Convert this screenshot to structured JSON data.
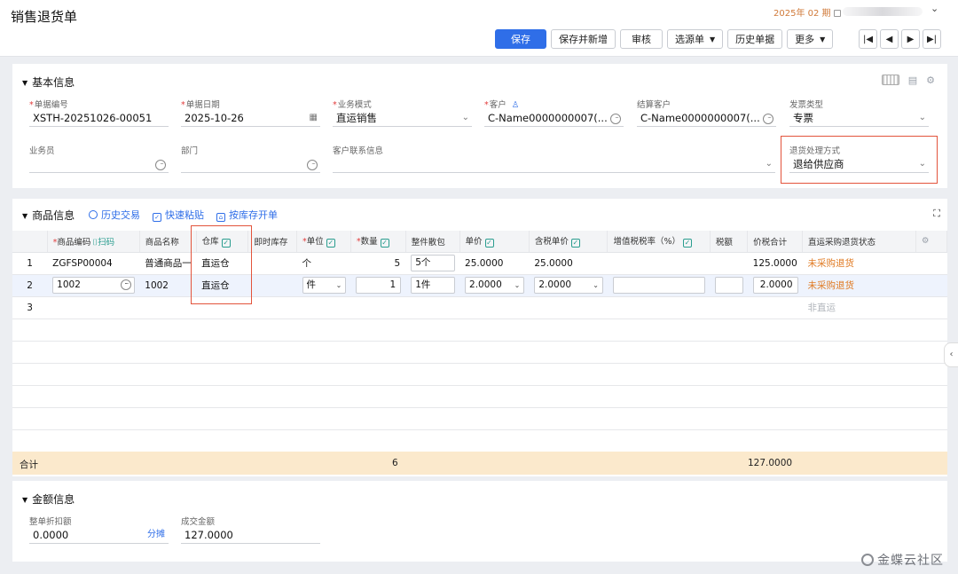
{
  "page": {
    "title": "销售退货单",
    "period": "2025年 02 期",
    "toolbar": {
      "save": "保存",
      "save_new": "保存并新增",
      "audit": "审核",
      "select_source": "选源单",
      "history": "历史单据",
      "more": "更多"
    },
    "nav": [
      "|◀",
      "◀",
      "▶",
      "▶|"
    ]
  },
  "basic": {
    "title": "基本信息",
    "fields": {
      "doc_no": {
        "label": "单据编号",
        "value": "XSTH-20251026-00051",
        "required": true
      },
      "doc_date": {
        "label": "单据日期",
        "value": "2025-10-26",
        "required": true
      },
      "biz_mode": {
        "label": "业务模式",
        "value": "直运销售",
        "required": true
      },
      "customer": {
        "label": "客户",
        "value": "C-Name0000000007(...",
        "required": true
      },
      "settle_customer": {
        "label": "结算客户",
        "value": "C-Name0000000007(..."
      },
      "invoice_type": {
        "label": "发票类型",
        "value": "专票"
      },
      "salesman": {
        "label": "业务员",
        "value": ""
      },
      "dept": {
        "label": "部门",
        "value": ""
      },
      "contact": {
        "label": "客户联系信息",
        "value": ""
      },
      "return_mode": {
        "label": "退货处理方式",
        "value": "退给供应商"
      }
    }
  },
  "goods": {
    "title": "商品信息",
    "links": {
      "history": "历史交易",
      "paste": "快速粘贴",
      "stock": "按库存开单"
    },
    "columns": {
      "code": "商品编码",
      "scan": "扫码",
      "name": "商品名称",
      "warehouse": "仓库",
      "stock": "即时库存",
      "unit": "单位",
      "qty": "数量",
      "pack": "整件散包",
      "price": "单价",
      "tax_price": "含税单价",
      "tax_rate": "增值税税率（%）",
      "tax": "税额",
      "total": "价税合计",
      "status": "直运采购退货状态"
    },
    "rows": [
      {
        "no": "1",
        "code": "ZGFSP00004",
        "name": "普通商品一",
        "warehouse": "直运仓",
        "unit": "个",
        "qty": "5",
        "pack": "5个",
        "price": "25.0000",
        "tax_price": "25.0000",
        "tax_rate": "",
        "tax": "",
        "total": "125.0000",
        "status": "未采购退货"
      },
      {
        "no": "2",
        "code": "1002",
        "name": "1002",
        "warehouse": "直运仓",
        "unit": "件",
        "qty": "1",
        "pack": "1件",
        "price": "2.0000",
        "tax_price": "2.0000",
        "tax_rate": "",
        "tax": "",
        "total": "2.0000",
        "status": "未采购退货"
      },
      {
        "no": "3",
        "status": "非直运"
      }
    ],
    "totals": {
      "label": "合计",
      "qty": "6",
      "total": "127.0000"
    }
  },
  "amount": {
    "title": "金额信息",
    "discount": {
      "label": "整单折扣额",
      "value": "0.0000",
      "action": "分摊"
    },
    "deal": {
      "label": "成交金额",
      "value": "127.0000"
    }
  },
  "watermark": "金蝶云社区",
  "colors": {
    "primary": "#2f6ee8",
    "highlight": "#e3543c",
    "status_orange": "#e07b24",
    "total_bg": "#fbe9cc"
  }
}
